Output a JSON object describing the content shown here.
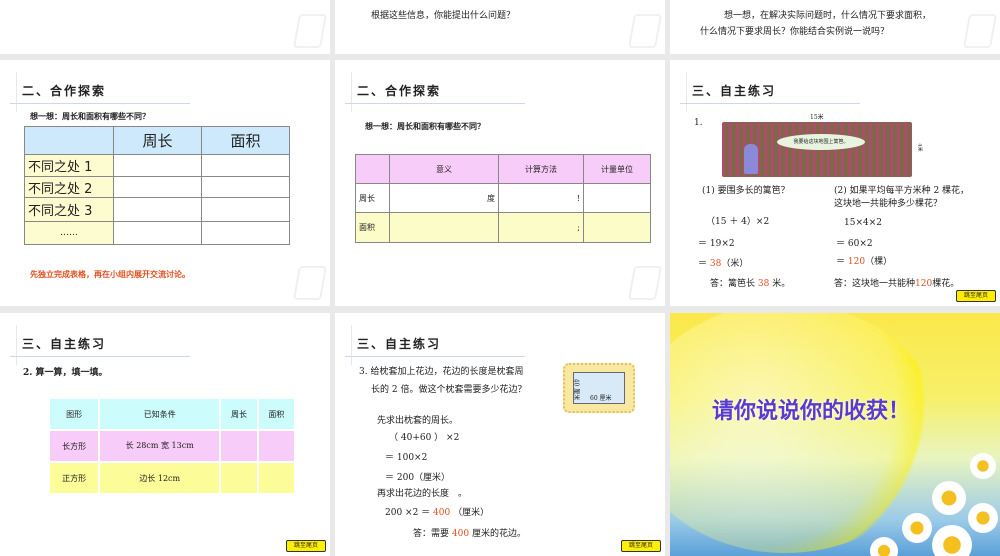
{
  "top_row": {
    "slide2_text": "根据这些信息，你能提出什么问题？",
    "slide3_line1": "想一想，在解决实际问题时，什么情况下要求面积，",
    "slide3_line2": "什么情况下要求周长？你能结合实例说一说吗？"
  },
  "slide4": {
    "title": "二、合作探索",
    "question": "想一想：周长和面积有哪些不同？",
    "headers": [
      "",
      "周长",
      "面积"
    ],
    "rows": [
      "不同之处 1",
      "不同之处 2",
      "不同之处 3",
      "……"
    ],
    "note": "先独立完成表格，再在小组内展开交流讨论。"
  },
  "slide5": {
    "title": "二、合作探索",
    "question": "想一想：周长和面积有哪些不同？",
    "headers": [
      "",
      "意义",
      "计算方法",
      "计量单位"
    ],
    "rows": [
      {
        "label": "周长",
        "c1": "度",
        "c2": "!"
      },
      {
        "label": "面积",
        "c1": "",
        "c2": ";"
      }
    ]
  },
  "slide6": {
    "title": "三、自主练习",
    "num": "1.",
    "img_top": "15米",
    "img_side": "4米",
    "bubble": "我要给这块地围上篱笆。",
    "q1": "(1) 要围多长的篱笆？",
    "q1_lines": [
      "（15 ＋ 4）×2",
      "＝ 19×2",
      "＝"
    ],
    "q1_result": "38",
    "q1_unit": "（米）",
    "q1_ans_pre": "答：篱笆长",
    "q1_ans_val": "38",
    "q1_ans_post": "米。",
    "q2": "(2) 如果平均每平方米种 2 棵花，这块地一共能种多少棵花？",
    "q2_lines": [
      "15×4×2",
      "＝ 60×2",
      "＝"
    ],
    "q2_result": "120",
    "q2_unit": "（棵）",
    "q2_ans_pre": "答：这块地一共能种",
    "q2_ans_val": "120",
    "q2_ans_post": "棵花。",
    "button": "跳至尾页"
  },
  "slide7": {
    "title": "三、自主练习",
    "question": "2. 算一算，填一填。",
    "headers": [
      "图形",
      "已知条件",
      "周长",
      "面积"
    ],
    "rows": [
      {
        "shape": "长方形",
        "cond": "长 28cm 宽 13cm"
      },
      {
        "shape": "正方形",
        "cond": "边长 12cm"
      }
    ],
    "button": "跳至尾页"
  },
  "slide8": {
    "title": "三、自主练习",
    "q_line1": "3. 给枕套加上花边，花边的长度是枕套周",
    "q_line2": "长的 2 倍。做这个枕套需要多少花边？",
    "img_w": "60 厘米",
    "img_h": "40 厘米",
    "step1": "先求出枕套的周长。",
    "l1": "（ 40+60 ） ×2",
    "l2": "＝ 100×2",
    "l3": "＝ 200（厘米）",
    "step2": "再求出花边的长度　。",
    "l4_pre": "200 ×2 ＝",
    "l4_val": "400",
    "l4_post": "（厘米）",
    "ans_pre": "答：需要",
    "ans_val": "400",
    "ans_post": "厘米的花边。",
    "button": "跳至尾页"
  },
  "slide9": {
    "text": "请你说说你的收获！"
  }
}
